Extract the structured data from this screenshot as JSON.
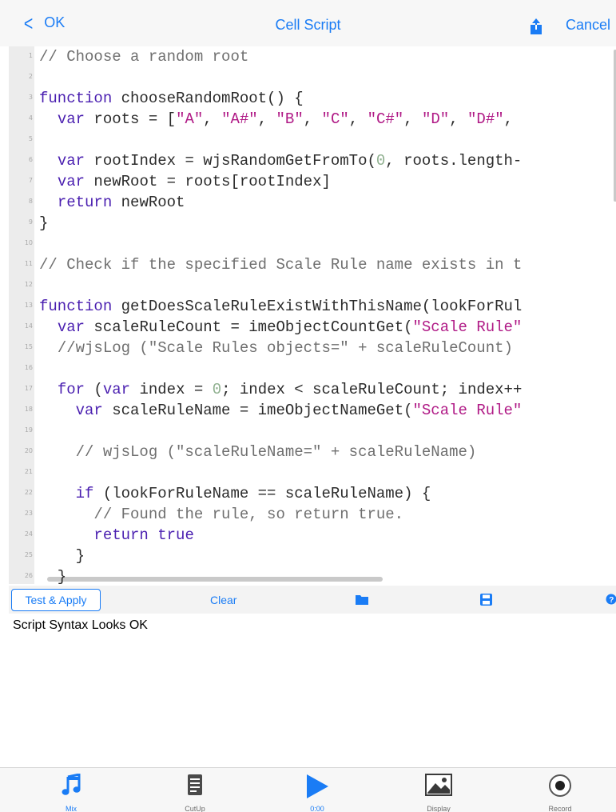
{
  "nav": {
    "back_label": "OK",
    "title": "Cell Script",
    "cancel_label": "Cancel",
    "share_icon": "share-icon"
  },
  "editor": {
    "lines": [
      {
        "n": "1",
        "code": "// Choose a random root"
      },
      {
        "n": "2",
        "code": ""
      },
      {
        "n": "3",
        "code": "function chooseRandomRoot() {"
      },
      {
        "n": "4",
        "code": "  var roots = [\"A\", \"A#\", \"B\", \"C\", \"C#\", \"D\", \"D#\","
      },
      {
        "n": "5",
        "code": ""
      },
      {
        "n": "6",
        "code": "  var rootIndex = wjsRandomGetFromTo(0, roots.length-"
      },
      {
        "n": "7",
        "code": "  var newRoot = roots[rootIndex]"
      },
      {
        "n": "8",
        "code": "  return newRoot"
      },
      {
        "n": "9",
        "code": "}"
      },
      {
        "n": "10",
        "code": ""
      },
      {
        "n": "11",
        "code": "// Check if the specified Scale Rule name exists in t"
      },
      {
        "n": "12",
        "code": ""
      },
      {
        "n": "13",
        "code": "function getDoesScaleRuleExistWithThisName(lookForRul"
      },
      {
        "n": "14",
        "code": "  var scaleRuleCount = imeObjectCountGet(\"Scale Rule\""
      },
      {
        "n": "15",
        "code": "  //wjsLog (\"Scale Rules objects=\" + scaleRuleCount)"
      },
      {
        "n": "16",
        "code": ""
      },
      {
        "n": "17",
        "code": "  for (var index = 0; index < scaleRuleCount; index++"
      },
      {
        "n": "18",
        "code": "    var scaleRuleName = imeObjectNameGet(\"Scale Rule\""
      },
      {
        "n": "19",
        "code": ""
      },
      {
        "n": "20",
        "code": "    // wjsLog (\"scaleRuleName=\" + scaleRuleName)"
      },
      {
        "n": "21",
        "code": ""
      },
      {
        "n": "22",
        "code": "    if (lookForRuleName == scaleRuleName) {"
      },
      {
        "n": "23",
        "code": "      // Found the rule, so return true."
      },
      {
        "n": "24",
        "code": "      return true"
      },
      {
        "n": "25",
        "code": "    }"
      },
      {
        "n": "26",
        "code": "  }"
      }
    ]
  },
  "actions": {
    "test_apply": "Test & Apply",
    "clear": "Clear",
    "open_icon": "folder-icon",
    "save_icon": "save-icon",
    "help_icon": "help-icon"
  },
  "output": {
    "text": "Script Syntax Looks OK"
  },
  "tabs": [
    {
      "label": "Mix",
      "icon": "music-note-icon",
      "active": true
    },
    {
      "label": "CutUp",
      "icon": "document-icon",
      "active": false
    },
    {
      "label": "0:00",
      "icon": "play-icon",
      "active": true
    },
    {
      "label": "Display",
      "icon": "image-icon",
      "active": false
    },
    {
      "label": "Record",
      "icon": "record-icon",
      "active": false
    }
  ],
  "colors": {
    "accent": "#1a7cf5",
    "keyword": "#4a1fb0",
    "string": "#b01a86",
    "number": "#8fb08f",
    "comment": "#6f6f6f"
  }
}
